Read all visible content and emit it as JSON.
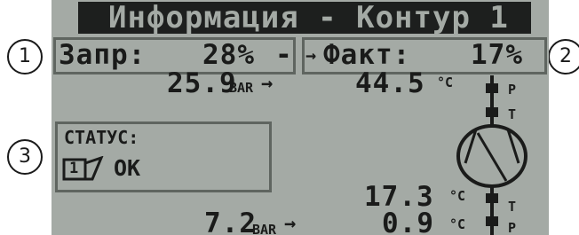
{
  "screen": {
    "title": "Информация - Контур 1",
    "setpoint": {
      "label": "Запр:",
      "value": "28%"
    },
    "actual": {
      "label": "Факт:",
      "value": "17%"
    },
    "readings": {
      "top_pressure": {
        "value": "25.9",
        "unit": "BAR"
      },
      "top_temp": {
        "value": "44.5",
        "unit": "°C"
      },
      "bottom_temp": {
        "value": "17.3",
        "unit": "°C"
      },
      "bottom_pressure": {
        "value": "7.2",
        "unit": "BAR"
      },
      "bottom_temp2": {
        "value": "0.9",
        "unit": "°C"
      }
    },
    "sensor_labels": {
      "p_top": "P",
      "t_top": "T",
      "t_bottom": "T",
      "p_bottom": "P"
    },
    "status": {
      "label": "СТАТУС:",
      "circuit_icon_number": "1",
      "value": "OK"
    }
  },
  "callouts": [
    "1",
    "2",
    "3"
  ],
  "colors": {
    "lcd_background": "#a4aaa5",
    "lcd_foreground": "#1a1b1a",
    "box_border": "#5f6560"
  }
}
